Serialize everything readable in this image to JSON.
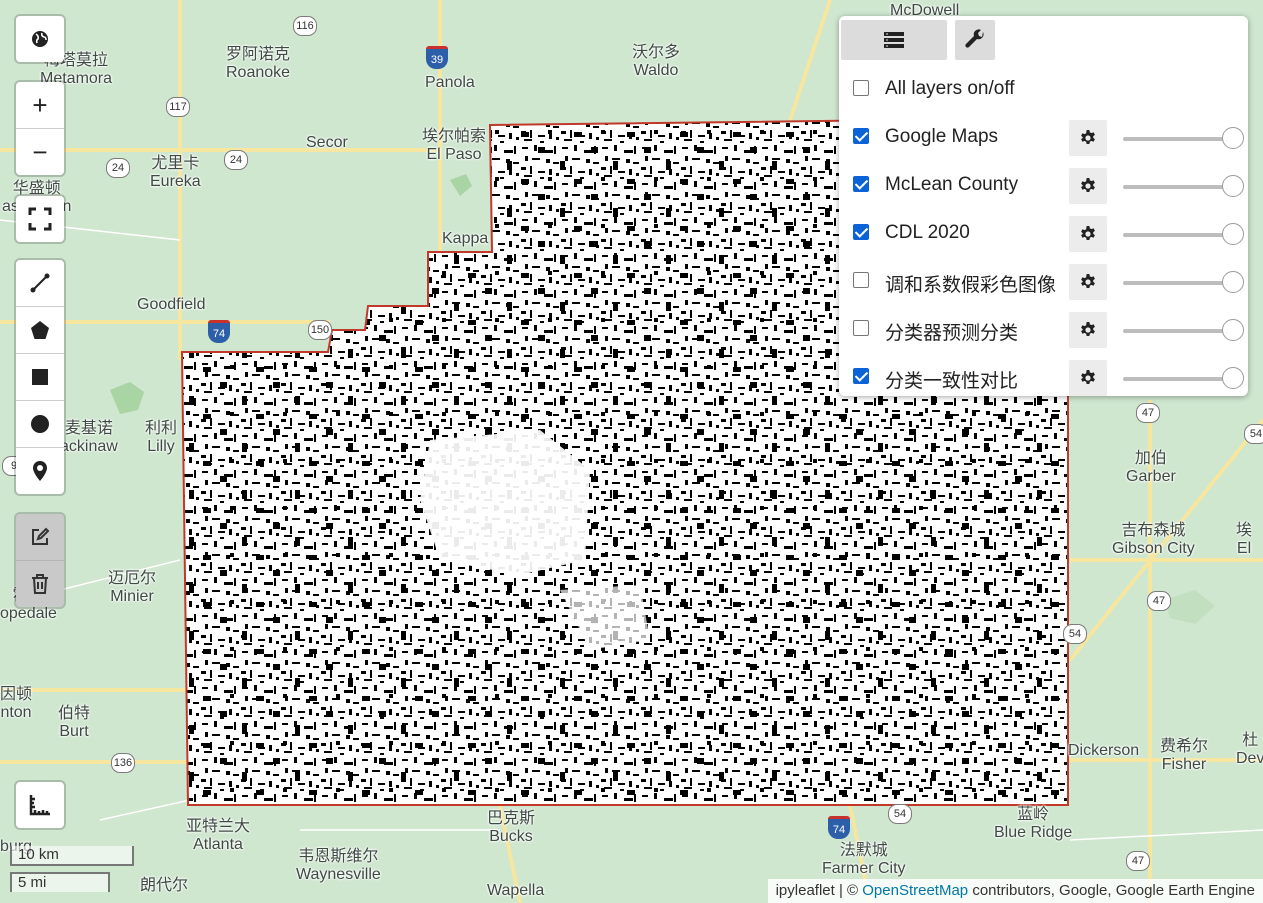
{
  "map": {
    "labels": [
      {
        "zh": "梅塔莫拉",
        "en": "Metamora"
      },
      {
        "zh": "罗阿诺克",
        "en": "Roanoke"
      },
      {
        "zh": "",
        "en": "Panola"
      },
      {
        "zh": "沃尔多",
        "en": "Waldo"
      },
      {
        "zh": "",
        "en": "Secor"
      },
      {
        "zh": "埃尔帕索",
        "en": "El Paso"
      },
      {
        "zh": "尤里卡",
        "en": "Eureka"
      },
      {
        "zh": "华盛顿",
        "en": "ashington"
      },
      {
        "zh": "",
        "en": "Kappa"
      },
      {
        "zh": "",
        "en": "Goodfield"
      },
      {
        "zh": "麦基诺",
        "en": "ackinaw"
      },
      {
        "zh": "利利",
        "en": "Lilly"
      },
      {
        "zh": "迈厄尔",
        "en": "Minier"
      },
      {
        "zh": "霍普",
        "en": "opedale"
      },
      {
        "zh": "因顿",
        "en": "nton"
      },
      {
        "zh": "伯特",
        "en": "Burt"
      },
      {
        "zh": "亚特兰大",
        "en": "Atlanta"
      },
      {
        "zh": "巴克斯",
        "en": "Bucks"
      },
      {
        "zh": "韦恩斯维尔",
        "en": "Waynesville"
      },
      {
        "zh": "",
        "en": "Wapella"
      },
      {
        "zh": "朗代尔",
        "en": ""
      },
      {
        "zh": "法默城",
        "en": "Farmer City"
      },
      {
        "zh": "蓝岭",
        "en": "Blue Ridge"
      },
      {
        "zh": "费希尔",
        "en": "Fisher"
      },
      {
        "zh": "",
        "en": "Dickerson"
      },
      {
        "zh": "吉布森城",
        "en": "Gibson City"
      },
      {
        "zh": "加伯",
        "en": "Garber"
      },
      {
        "zh": "",
        "en": "McDowell"
      },
      {
        "zh": "杜",
        "en": "Dev"
      },
      {
        "zh": "埃",
        "en": "El"
      },
      {
        "zh": "",
        "en": "burg"
      }
    ],
    "route_shields": [
      "116",
      "117",
      "24",
      "24",
      "150",
      "9",
      "136",
      "39",
      "74",
      "74",
      "54",
      "47",
      "47",
      "47",
      "54",
      "54"
    ]
  },
  "toolbar": {
    "basemap_icon": "globe-icon",
    "zoom_in": "+",
    "zoom_out": "−",
    "fullscreen_icon": "fullscreen-icon",
    "draw_tools": [
      "polyline-icon",
      "polygon-icon",
      "rectangle-icon",
      "circle-icon",
      "marker-icon"
    ],
    "edit_icon": "edit-icon",
    "delete_icon": "trash-icon",
    "measure_icon": "ruler-icon"
  },
  "layer_panel": {
    "toggle_all": {
      "label": "All layers on/off",
      "checked": false
    },
    "layers": [
      {
        "label": "Google Maps",
        "checked": true,
        "opacity": 1.0
      },
      {
        "label": "McLean County",
        "checked": true,
        "opacity": 1.0
      },
      {
        "label": "CDL 2020",
        "checked": true,
        "opacity": 1.0
      },
      {
        "label": "调和系数假彩色图像",
        "checked": false,
        "opacity": 1.0
      },
      {
        "label": "分类器预测分类",
        "checked": false,
        "opacity": 1.0
      },
      {
        "label": "分类一致性对比",
        "checked": true,
        "opacity": 1.0
      }
    ]
  },
  "scale": {
    "km": "10 km",
    "mi": "5 mi"
  },
  "attribution": {
    "prefix": "ipyleaflet | © ",
    "link": "OpenStreetMap",
    "suffix": " contributors, Google, Google Earth Engine"
  },
  "colors": {
    "county_border": "#c0392b",
    "classification_dark": "#000000",
    "classification_light": "#ffffff",
    "accent": "#0b63d6"
  }
}
